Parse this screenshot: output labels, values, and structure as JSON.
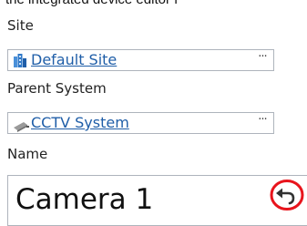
{
  "caption_fragment": "the integrated device editor f",
  "site": {
    "label": "Site",
    "value": "Default Site",
    "icon": "building-icon",
    "more": "···"
  },
  "parent_system": {
    "label": "Parent System",
    "value": "CCTV System",
    "icon": "cctv-camera-icon",
    "more": "···"
  },
  "name": {
    "label": "Name",
    "value": "Camera 1",
    "revert_icon": "undo-arrow-icon",
    "highlight_color": "#e8141c"
  },
  "colors": {
    "link": "#1f5ea8",
    "border": "#aeb4bc",
    "building_icon": "#2e78c8"
  }
}
